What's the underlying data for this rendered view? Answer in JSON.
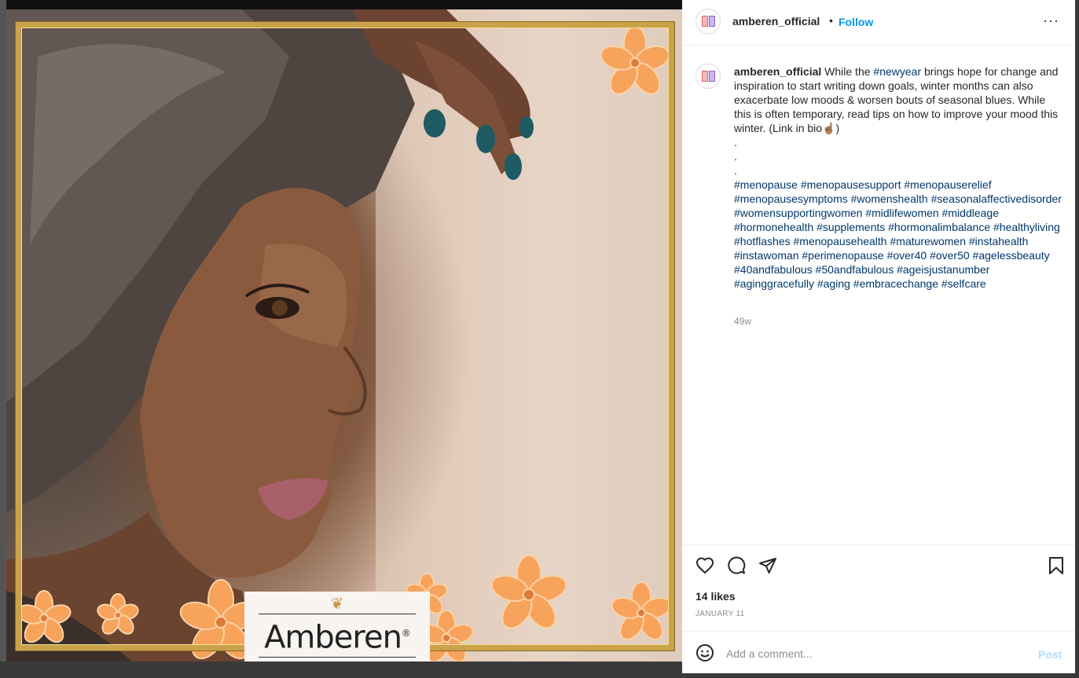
{
  "post": {
    "username": "amberen_official",
    "follow_label": "Follow",
    "separator": "•",
    "more_glyph": "···",
    "brand_name": "Amberen",
    "brand_mark": "®",
    "caption": {
      "username": "amberen_official",
      "text_before": "While the ",
      "hashtag_inline": "#newyear",
      "text_after": " brings hope for change and inspiration to start writing down goals, winter months can also exacerbate low moods & worsen bouts of seasonal blues. While this is often temporary, read tips on how to improve your mood this winter. (Link in bio☝🏽)",
      "dots": ".",
      "hashtags": [
        "#menopause",
        "#menopausesupport",
        "#menopauserelief",
        "#menopausesymptoms",
        "#womenshealth",
        "#seasonalaffectivedisorder",
        "#womensupportingwomen",
        "#midlifewomen",
        "#middleage",
        "#hormonehealth",
        "#supplements",
        "#hormonalimbalance",
        "#healthyliving",
        "#hotflashes",
        "#menopausehealth",
        "#maturewomen",
        "#instahealth",
        "#instawoman",
        "#perimenopause",
        "#over40",
        "#over50",
        "#agelessbeauty",
        "#40andfabulous",
        "#50andfabulous",
        "#ageisjustanumber",
        "#aginggracefully",
        "#aging",
        "#embracechange",
        "#selfcare"
      ],
      "age": "49w"
    },
    "likes": "14 likes",
    "date": "JANUARY 11",
    "comment_placeholder": "Add a comment...",
    "post_label": "Post"
  },
  "colors": {
    "link": "#00376b",
    "follow": "#0095f6",
    "post_disabled": "#b3dbff",
    "frame_gold": "#c9a24a",
    "flower": "#f7a35c"
  },
  "icons": [
    "heart-icon",
    "comment-icon",
    "share-icon",
    "bookmark-icon",
    "emoji-icon",
    "more-options-icon"
  ]
}
